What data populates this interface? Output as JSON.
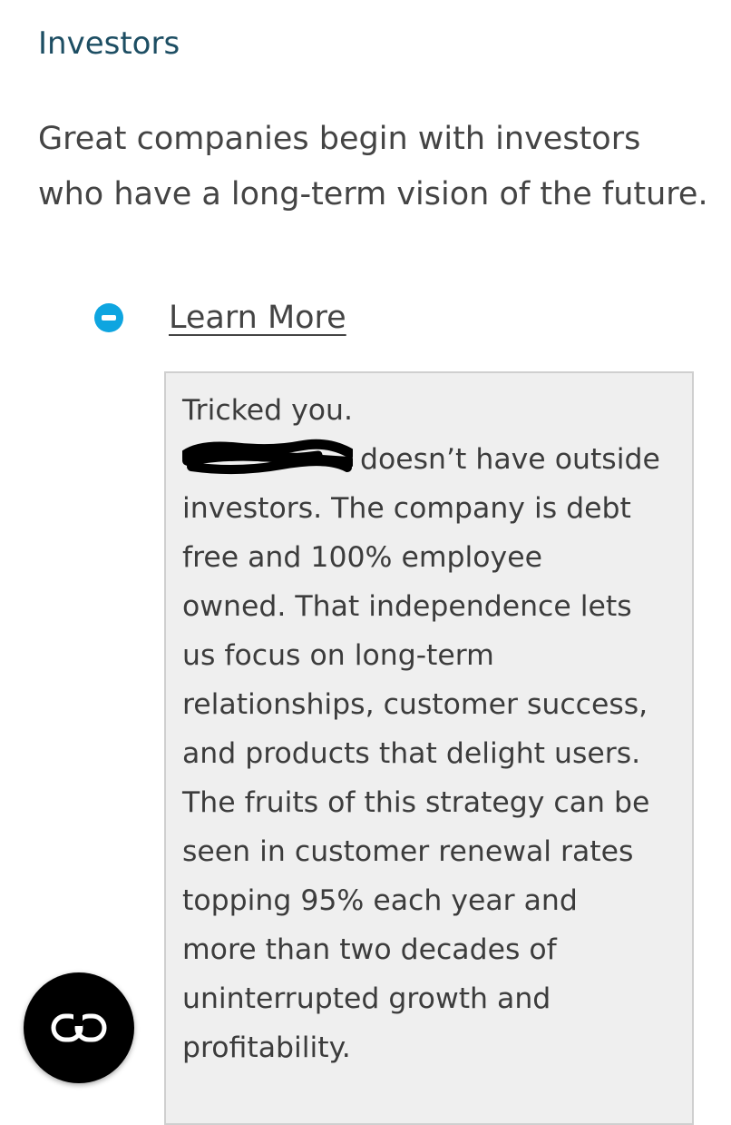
{
  "section": {
    "title": "Investors",
    "intro": "Great companies begin with investors who have a long-term vision of the future."
  },
  "toggle": {
    "label": "Learn More",
    "icon": "minus-circle-icon",
    "accent_color": "#0ea5e0"
  },
  "panel": {
    "lines": [
      "Tricked you.",
      "doesn’t have outside",
      "investors. The company is debt",
      "free and 100% employee",
      "owned. That independence lets",
      "us focus on long-term",
      "relationships, customer success,",
      "and products that delight users.",
      "The fruits of this strategy can be",
      "seen in customer renewal rates",
      "topping 95% each year and",
      "more than two decades of",
      "uninterrupted growth and",
      "profitability."
    ]
  },
  "fab": {
    "icon": "chain-link-icon"
  }
}
